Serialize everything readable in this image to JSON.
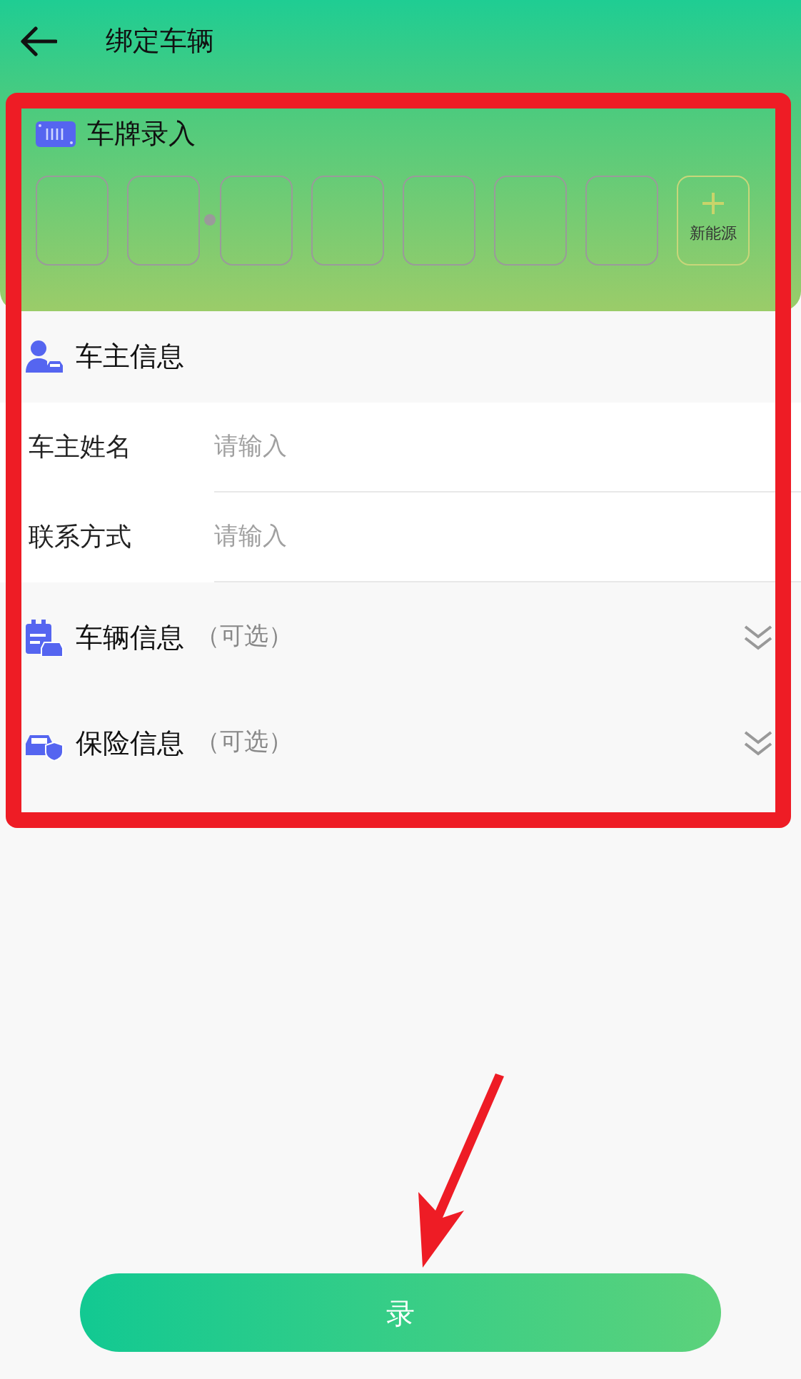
{
  "header": {
    "title": "绑定车辆"
  },
  "plate": {
    "title": "车牌录入",
    "new_energy_label": "新能源"
  },
  "owner": {
    "title": "车主信息",
    "fields": [
      {
        "label": "车主姓名",
        "placeholder": "请输入"
      },
      {
        "label": "联系方式",
        "placeholder": "请输入"
      }
    ]
  },
  "optional_sections": [
    {
      "kind": "vehicle",
      "title": "车辆信息",
      "note": "（可选）",
      "expanded": false
    },
    {
      "kind": "insurance",
      "title": "保险信息",
      "note": "（可选）",
      "expanded": false
    }
  ],
  "submit_button": {
    "label": "录"
  }
}
